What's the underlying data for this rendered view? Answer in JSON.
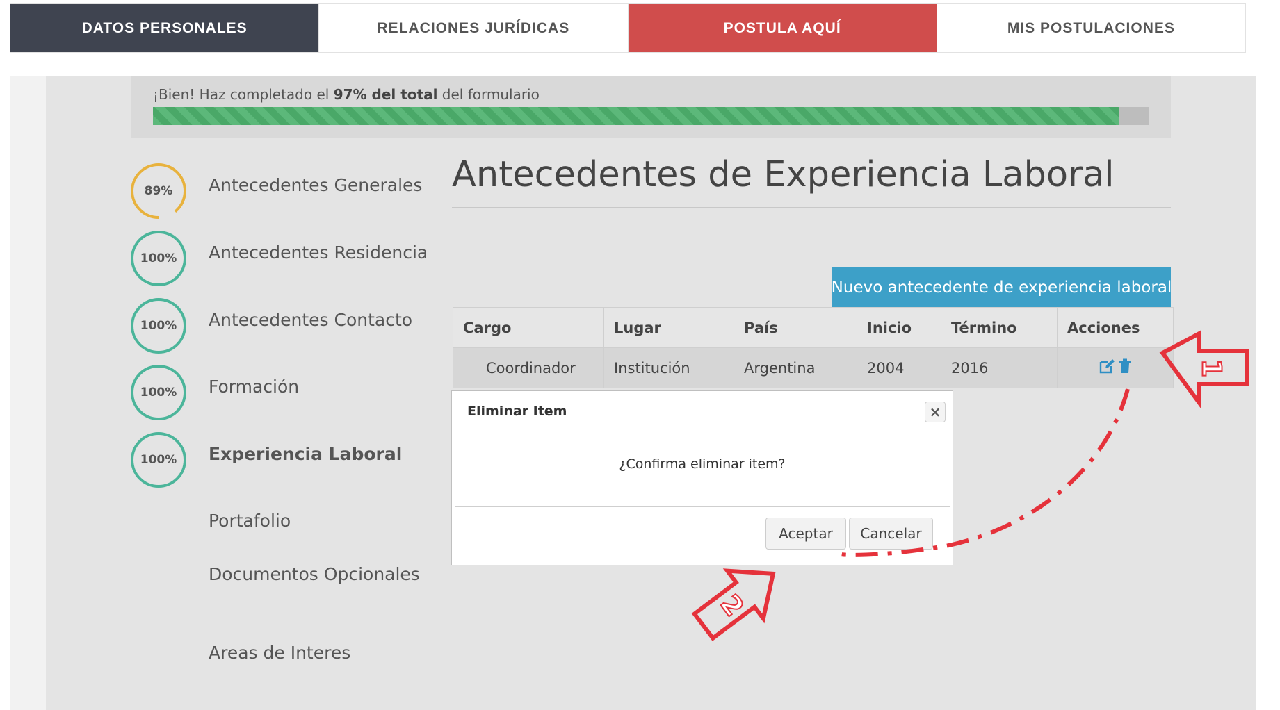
{
  "nav": {
    "tabs": [
      {
        "label": "DATOS PERSONALES",
        "state": "active"
      },
      {
        "label": "RELACIONES JURÍDICAS",
        "state": "normal"
      },
      {
        "label": "POSTULA AQUÍ",
        "state": "highlight"
      },
      {
        "label": "MIS POSTULACIONES",
        "state": "normal"
      }
    ]
  },
  "progress": {
    "prefix": "¡Bien! Haz completado el ",
    "bold": "97% del total",
    "suffix": " del formulario",
    "percent": 97
  },
  "sidebar": {
    "items": [
      {
        "label": "Antecedentes Generales",
        "percent_label": "89%",
        "percent": 89,
        "active": false
      },
      {
        "label": "Antecedentes Residencia",
        "percent_label": "100%",
        "percent": 100,
        "active": false
      },
      {
        "label": "Antecedentes Contacto",
        "percent_label": "100%",
        "percent": 100,
        "active": false
      },
      {
        "label": "Formación",
        "percent_label": "100%",
        "percent": 100,
        "active": false
      },
      {
        "label": "Experiencia Laboral",
        "percent_label": "100%",
        "percent": 100,
        "active": true
      },
      {
        "label": "Portafolio"
      },
      {
        "label": "Documentos Opcionales"
      },
      {
        "label": "Areas de Interes"
      }
    ]
  },
  "main": {
    "title": "Antecedentes de Experiencia Laboral",
    "new_button": "Nuevo antecedente de experiencia laboral",
    "table": {
      "headers": [
        "Cargo",
        "Lugar",
        "País",
        "Inicio",
        "Término",
        "Acciones"
      ],
      "rows": [
        [
          "Coordinador",
          "Institución",
          "Argentina",
          "2004",
          "2016"
        ]
      ]
    }
  },
  "modal": {
    "title": "Eliminar Item",
    "close": "×",
    "message": "¿Confirma eliminar item?",
    "accept": "Aceptar",
    "cancel": "Cancelar"
  },
  "annotations": {
    "arrow_1": "1",
    "arrow_2": "2"
  },
  "colors": {
    "nav_dark": "#3f4450",
    "nav_red": "#d04d4c",
    "progress_green": "#5cb87a",
    "circle_partial": "#e8b23d",
    "circle_full": "#4bb59a",
    "new_button": "#3da0c8",
    "annotation_red": "#e5323b",
    "action_icons": "#2f8fc4"
  }
}
